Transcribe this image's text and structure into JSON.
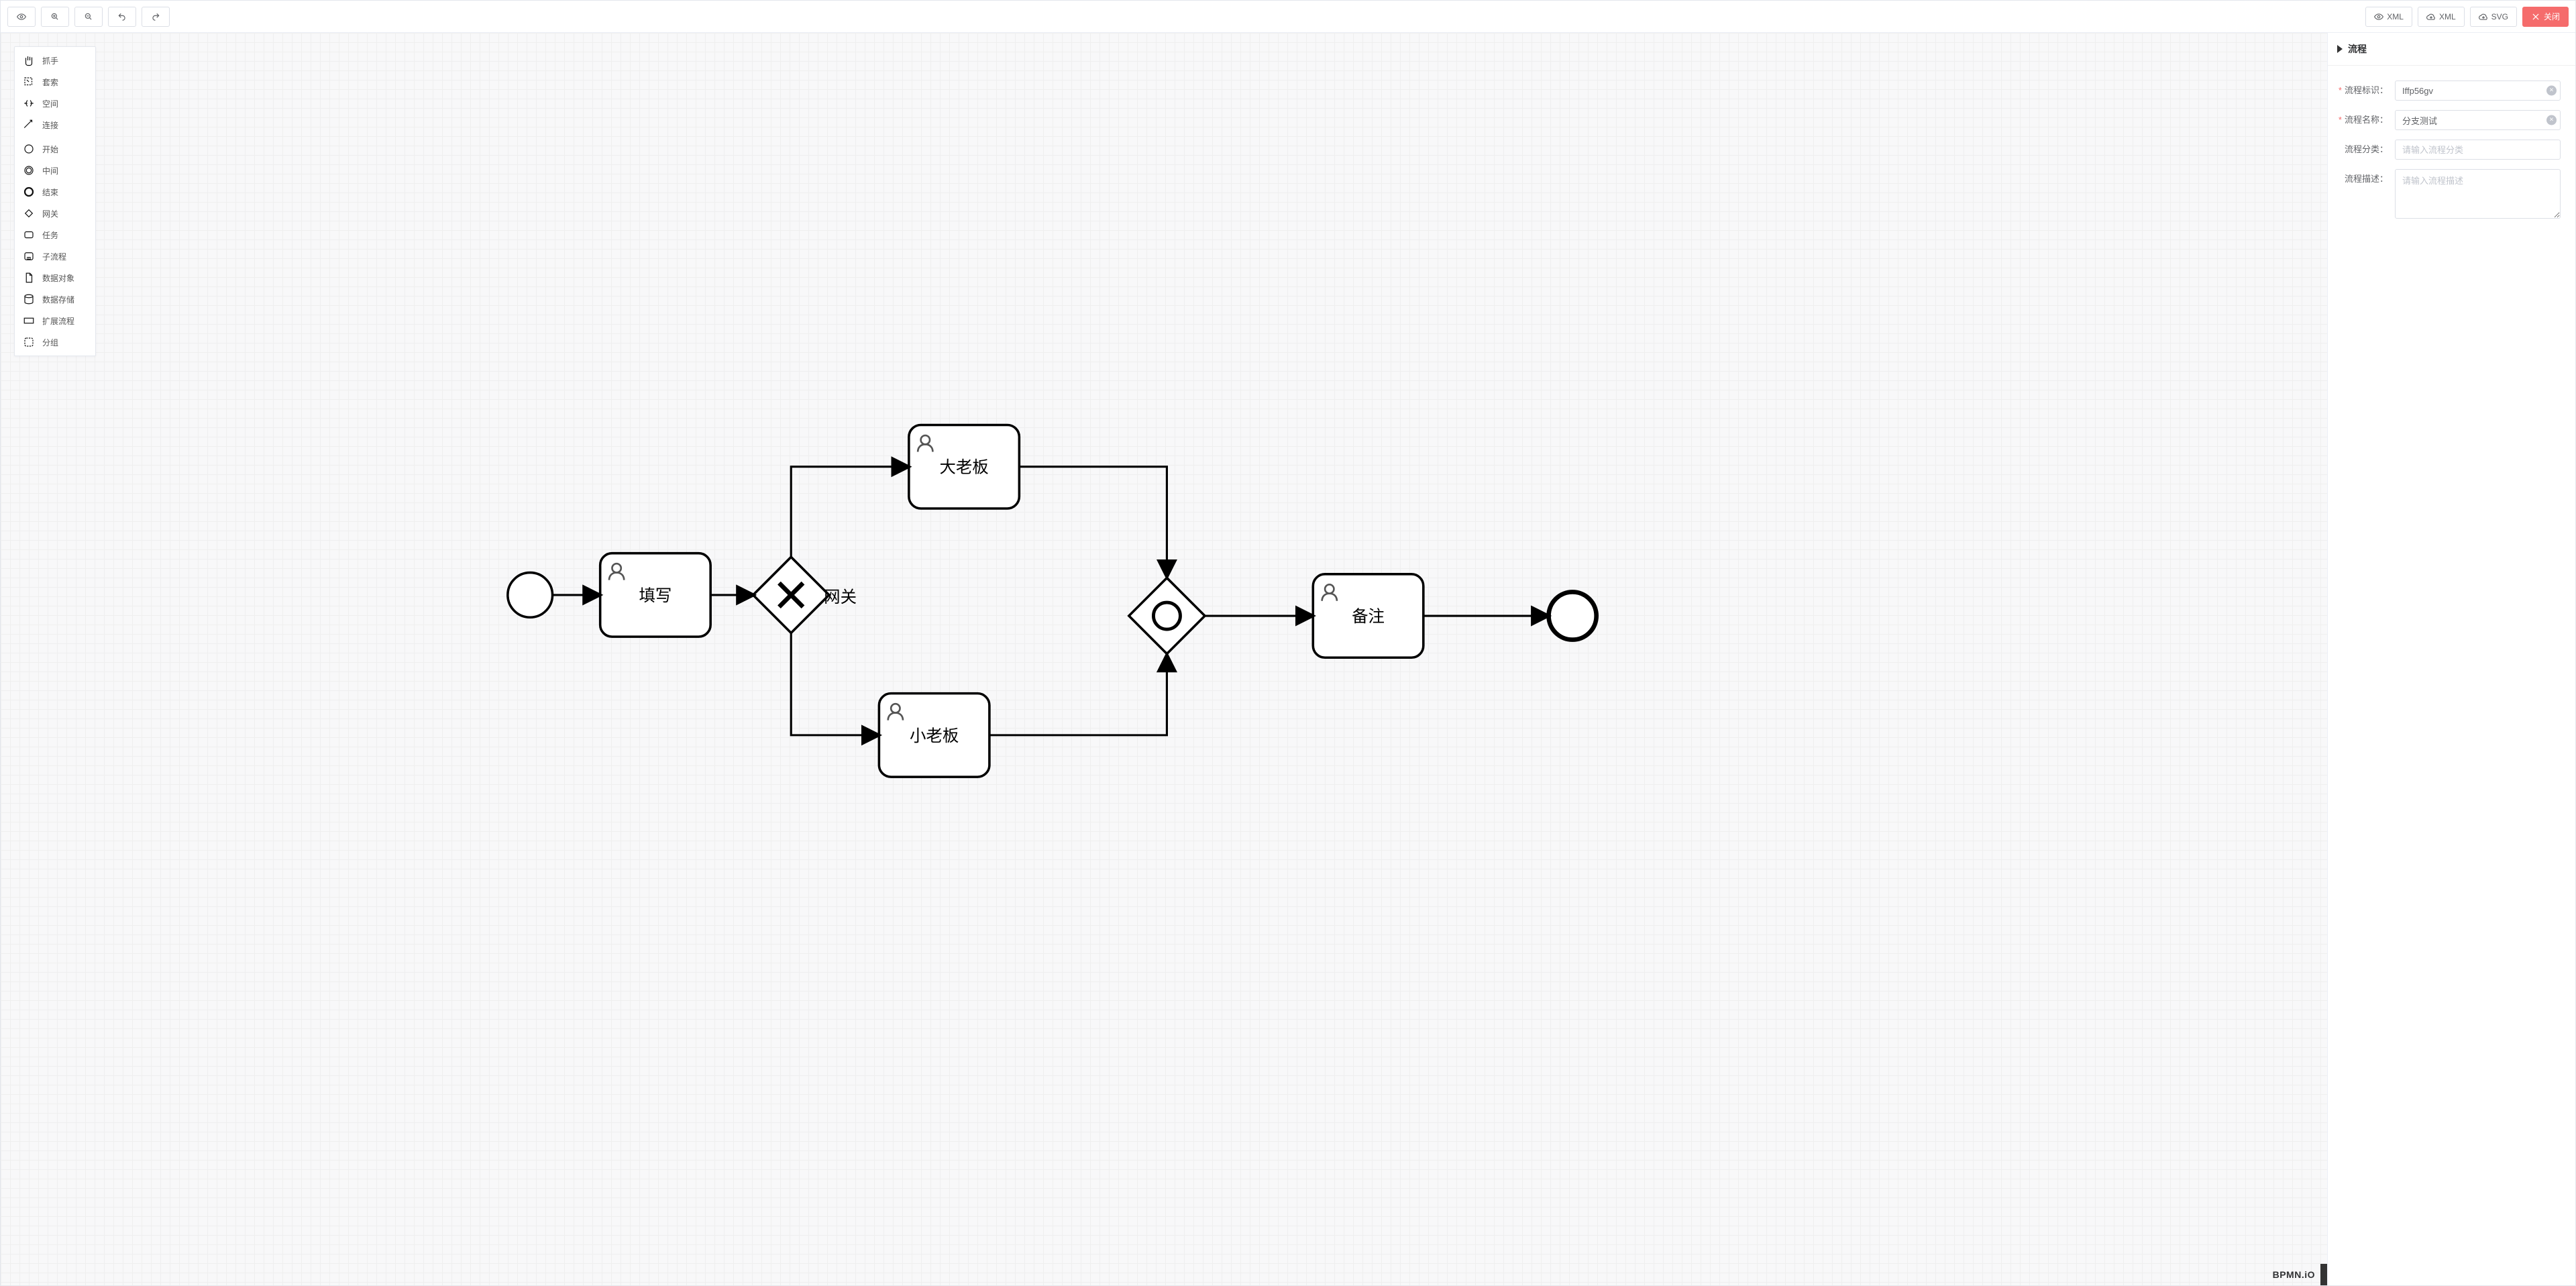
{
  "toolbar": {
    "view_xml": "XML",
    "download_xml": "XML",
    "download_svg": "SVG",
    "close": "关闭"
  },
  "palette": [
    {
      "id": "hand",
      "label": "抓手"
    },
    {
      "id": "lasso",
      "label": "套索"
    },
    {
      "id": "space",
      "label": "空间"
    },
    {
      "id": "connect",
      "label": "连接"
    },
    {
      "id": "start",
      "label": "开始"
    },
    {
      "id": "inter",
      "label": "中间"
    },
    {
      "id": "end",
      "label": "结束"
    },
    {
      "id": "gateway",
      "label": "网关"
    },
    {
      "id": "task",
      "label": "任务"
    },
    {
      "id": "sub",
      "label": "子流程"
    },
    {
      "id": "dataobj",
      "label": "数据对象"
    },
    {
      "id": "datastr",
      "label": "数据存储"
    },
    {
      "id": "expand",
      "label": "扩展流程"
    },
    {
      "id": "group",
      "label": "分组"
    }
  ],
  "diagram": {
    "gateway_label": "网关",
    "tasks": {
      "fill": "填写",
      "big": "大老板",
      "small": "小老板",
      "remark": "备注"
    }
  },
  "panel": {
    "header": "流程",
    "labels": {
      "process_id": "流程标识：",
      "process_name": "流程名称：",
      "category": "流程分类：",
      "desc": "流程描述："
    },
    "values": {
      "process_id": "Iffp56gv",
      "process_name": "分支测试",
      "category": "",
      "desc": ""
    },
    "placeholders": {
      "category": "请输入流程分类",
      "desc": "请输入流程描述"
    }
  },
  "footer_logo": "BPMN.iO"
}
